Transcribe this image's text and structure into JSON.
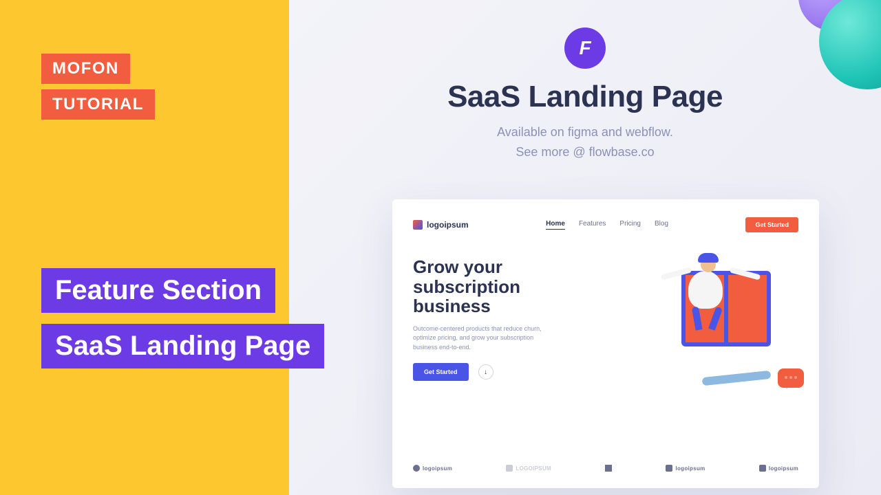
{
  "tags": {
    "brand": "MOFON",
    "type": "TUTORIAL"
  },
  "titles": {
    "line1": "Feature Section",
    "line2": "SaaS Landing Page"
  },
  "header": {
    "heading": "SaaS Landing Page",
    "sub1": "Available on figma and webflow.",
    "sub2": "See more @ flowbase.co"
  },
  "preview": {
    "logo": "logoipsum",
    "nav": {
      "home": "Home",
      "features": "Features",
      "pricing": "Pricing",
      "blog": "Blog"
    },
    "cta": "Get Started",
    "hero": {
      "title1": "Grow your",
      "title2": "subscription",
      "title3": "business",
      "desc": "Outcome-centered products that reduce churn, optimize pricing, and grow your subscription business end-to-end.",
      "button": "Get Started"
    },
    "logos": {
      "a": "logoipsum",
      "b": "LOGOIPSUM",
      "c": "logoipsum",
      "d": "logoipsum"
    }
  }
}
